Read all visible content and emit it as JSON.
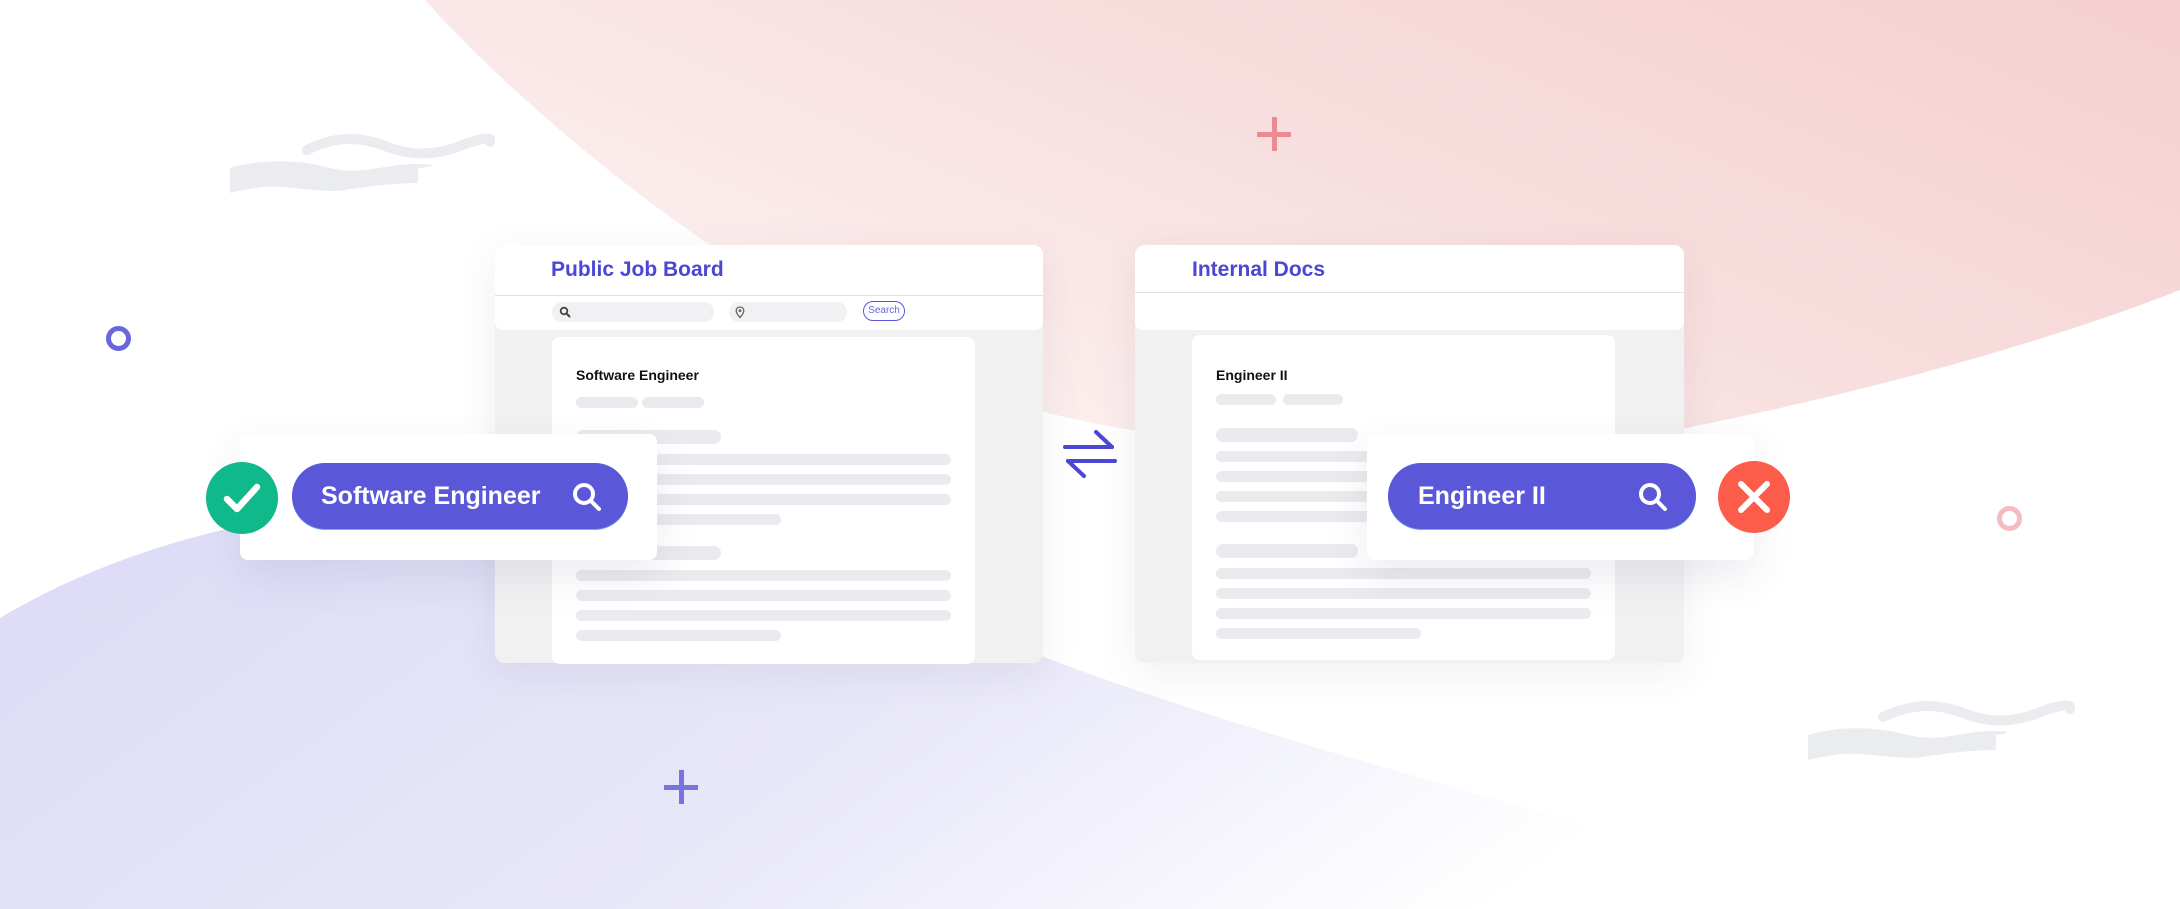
{
  "colors": {
    "accent": "#5a58d9",
    "title_blue": "#4b46d4",
    "success": "#10b98a",
    "error": "#fc5c4a",
    "pink_bg": "#f6d3d4",
    "lavender_bg": "#dcdaf6",
    "skeleton": "#eaebee"
  },
  "left_window": {
    "title": "Public Job Board",
    "search_button_label": "Search",
    "keyword_icon": "search-icon",
    "location_icon": "location-pin-icon",
    "document": {
      "heading": "Software Engineer"
    }
  },
  "right_window": {
    "title": "Internal Docs",
    "document": {
      "heading": "Engineer II"
    }
  },
  "left_callout": {
    "query": "Software Engineer",
    "status_icon": "check-icon",
    "status": "match",
    "search_icon": "search-icon"
  },
  "right_callout": {
    "query": "Engineer II",
    "status_icon": "close-icon",
    "status": "no-match",
    "search_icon": "search-icon"
  },
  "center_icon": "swap-arrows-icon",
  "decorations": [
    "plus-icon",
    "ring-icon",
    "wave-icon"
  ]
}
